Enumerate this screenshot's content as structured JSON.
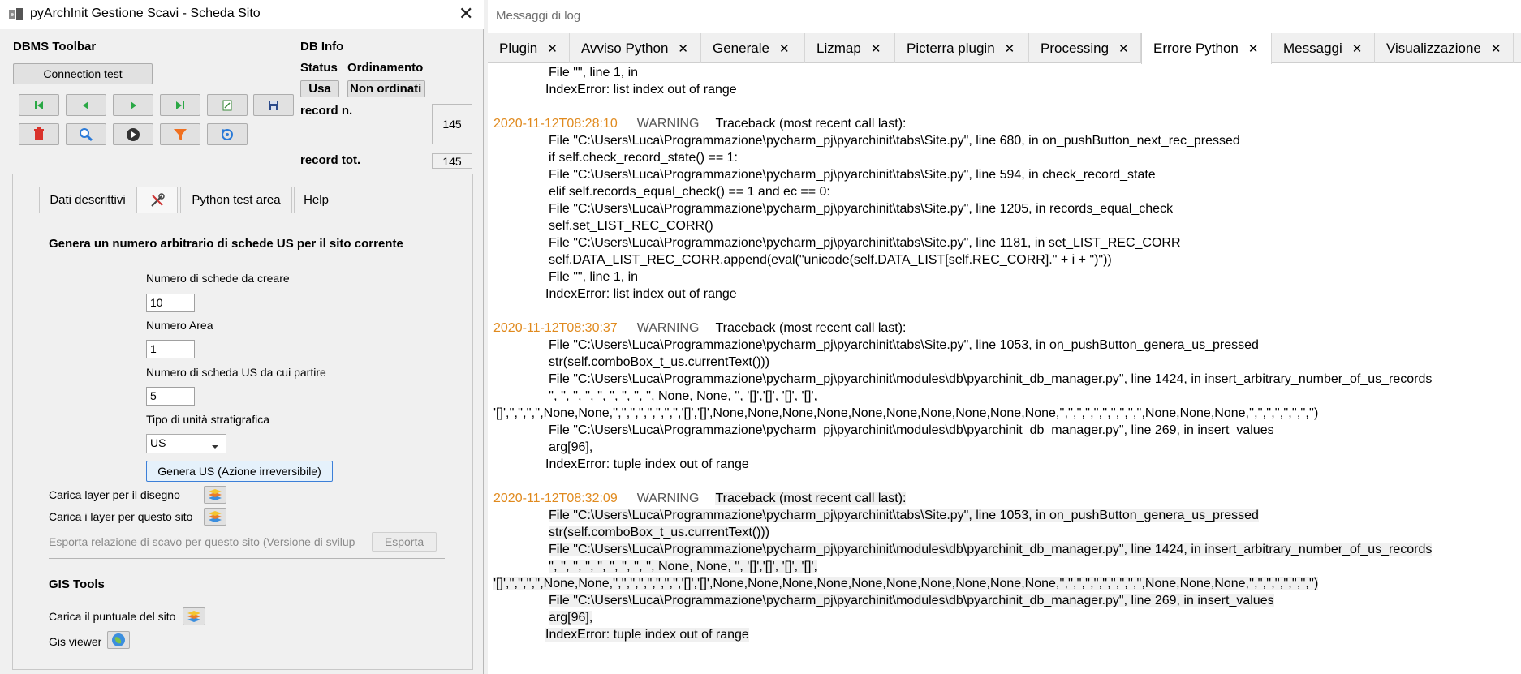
{
  "dialog": {
    "title": "pyArchInit Gestione Scavi - Scheda Sito",
    "dbms_toolbar_label": "DBMS Toolbar",
    "connection_test": "Connection test",
    "db_info": "DB Info",
    "status_label": "Status",
    "ordinamento_label": "Ordinamento",
    "usa_button": "Usa",
    "ordinamento_value": "Non ordinati",
    "record_n_label": "record n.",
    "record_n_value": "145",
    "record_tot_label": "record tot.",
    "record_tot_value": "145",
    "nav_icons": [
      "first-record-icon",
      "prev-record-icon",
      "next-record-icon",
      "last-record-icon",
      "new-record-icon",
      "save-icon"
    ],
    "action_icons": [
      "delete-icon",
      "search-icon",
      "run-icon",
      "filter-icon",
      "refresh-icon"
    ],
    "tabs": [
      {
        "label": "Dati descrittivi"
      },
      {
        "label": "",
        "icon": "tools-icon"
      },
      {
        "label": "Python test area"
      },
      {
        "label": "Help"
      }
    ],
    "section_title": "Genera un numero arbitrario di schede US per il sito corrente",
    "num_schede_label": "Numero di schede da creare",
    "num_schede_value": "10",
    "numero_area_label": "Numero Area",
    "numero_area_value": "1",
    "numero_us_label": "Numero di scheda US da cui partire",
    "numero_us_value": "5",
    "tipo_label": "Tipo di unità stratigrafica",
    "tipo_value": "US",
    "genera_button": "Genera US (Azione irreversibile)",
    "carica_disegno": "Carica layer per il disegno",
    "carica_sito": "Carica i layer per questo sito",
    "esporta_label": "Esporta relazione di scavo per questo sito (Versione di svilup",
    "esporta_button": "Esporta",
    "gis_tools": "GIS Tools",
    "carica_puntuale": "Carica il puntuale del sito",
    "gis_viewer": "Gis viewer"
  },
  "log": {
    "title": "Messaggi di log",
    "tabs": [
      {
        "label": "Plugin"
      },
      {
        "label": "Avviso Python"
      },
      {
        "label": "Generale"
      },
      {
        "label": "Lizmap"
      },
      {
        "label": "Picterra plugin"
      },
      {
        "label": "Processing"
      },
      {
        "label": "Errore Python"
      },
      {
        "label": "Messaggi"
      },
      {
        "label": "Visualizzazione"
      }
    ],
    "active_tab": "Errore Python",
    "lines": [
      {
        "text": "File \"\", line 1, in"
      },
      {
        "text": "IndexError: list index out of range"
      },
      {
        "ts": "2020-11-12T08:28:10",
        "level": "WARNING",
        "text": "Traceback (most recent call last):"
      },
      {
        "text": "File \"C:\\Users\\Luca\\Programmazione\\pycharm_pj\\pyarchinit\\tabs\\Site.py\", line 680, in on_pushButton_next_rec_pressed"
      },
      {
        "text": "if self.check_record_state() == 1:"
      },
      {
        "text": "File \"C:\\Users\\Luca\\Programmazione\\pycharm_pj\\pyarchinit\\tabs\\Site.py\", line 594, in check_record_state"
      },
      {
        "text": "elif self.records_equal_check() == 1 and ec == 0:"
      },
      {
        "text": "File \"C:\\Users\\Luca\\Programmazione\\pycharm_pj\\pyarchinit\\tabs\\Site.py\", line 1205, in records_equal_check"
      },
      {
        "text": "self.set_LIST_REC_CORR()"
      },
      {
        "text": "File \"C:\\Users\\Luca\\Programmazione\\pycharm_pj\\pyarchinit\\tabs\\Site.py\", line 1181, in set_LIST_REC_CORR"
      },
      {
        "text": "self.DATA_LIST_REC_CORR.append(eval(\"unicode(self.DATA_LIST[self.REC_CORR].\" + i + \")\"))"
      },
      {
        "text": "File \"\", line 1, in"
      },
      {
        "text": "IndexError: list index out of range"
      },
      {
        "ts": "2020-11-12T08:30:37",
        "level": "WARNING",
        "text": "Traceback (most recent call last):"
      },
      {
        "text": "File \"C:\\Users\\Luca\\Programmazione\\pycharm_pj\\pyarchinit\\tabs\\Site.py\", line 1053, in on_pushButton_genera_us_pressed"
      },
      {
        "text": "str(self.comboBox_t_us.currentText()))"
      },
      {
        "text": "File \"C:\\Users\\Luca\\Programmazione\\pycharm_pj\\pyarchinit\\modules\\db\\pyarchinit_db_manager.py\", line 1424, in insert_arbitrary_number_of_us_records"
      },
      {
        "text": "'', '', '', '', '', '', '', '', '', None, None, '', '[]','[]', '[]', '[]',"
      },
      {
        "text": "'[]','','','','',None,None,'','','','','','','','','[]','[]',None,None,None,None,None,None,None,None,None,None,'','','','','','','','','','',None,None,None,'','','','','','','','')"
      },
      {
        "text": "File \"C:\\Users\\Luca\\Programmazione\\pycharm_pj\\pyarchinit\\modules\\db\\pyarchinit_db_manager.py\", line 269, in insert_values"
      },
      {
        "text": "arg[96],"
      },
      {
        "text": "IndexError: tuple index out of range"
      },
      {
        "ts": "2020-11-12T08:32:09",
        "level": "WARNING",
        "text": "Traceback (most recent call last):"
      },
      {
        "text": "File \"C:\\Users\\Luca\\Programmazione\\pycharm_pj\\pyarchinit\\tabs\\Site.py\", line 1053, in on_pushButton_genera_us_pressed"
      },
      {
        "text": "str(self.comboBox_t_us.currentText()))"
      },
      {
        "text": "File \"C:\\Users\\Luca\\Programmazione\\pycharm_pj\\pyarchinit\\modules\\db\\pyarchinit_db_manager.py\", line 1424, in insert_arbitrary_number_of_us_records"
      },
      {
        "text": "'', '', '', '', '', '', '', '', '', None, None, '', '[]','[]', '[]', '[]',"
      },
      {
        "text": "'[]','','','','',None,None,'','','','','','','','','[]','[]',None,None,None,None,None,None,None,None,None,None,'','','','','','','','','','',None,None,None,'','','','','','','','')"
      },
      {
        "text": "File \"C:\\Users\\Luca\\Programmazione\\pycharm_pj\\pyarchinit\\modules\\db\\pyarchinit_db_manager.py\", line 269, in insert_values"
      },
      {
        "text": "arg[96],"
      },
      {
        "text": "IndexError: tuple index out of range"
      }
    ]
  },
  "colors": {
    "timestamp": "#e08a1e",
    "dialog_bg": "#f0f0f0",
    "log_bg": "#ffffff"
  }
}
